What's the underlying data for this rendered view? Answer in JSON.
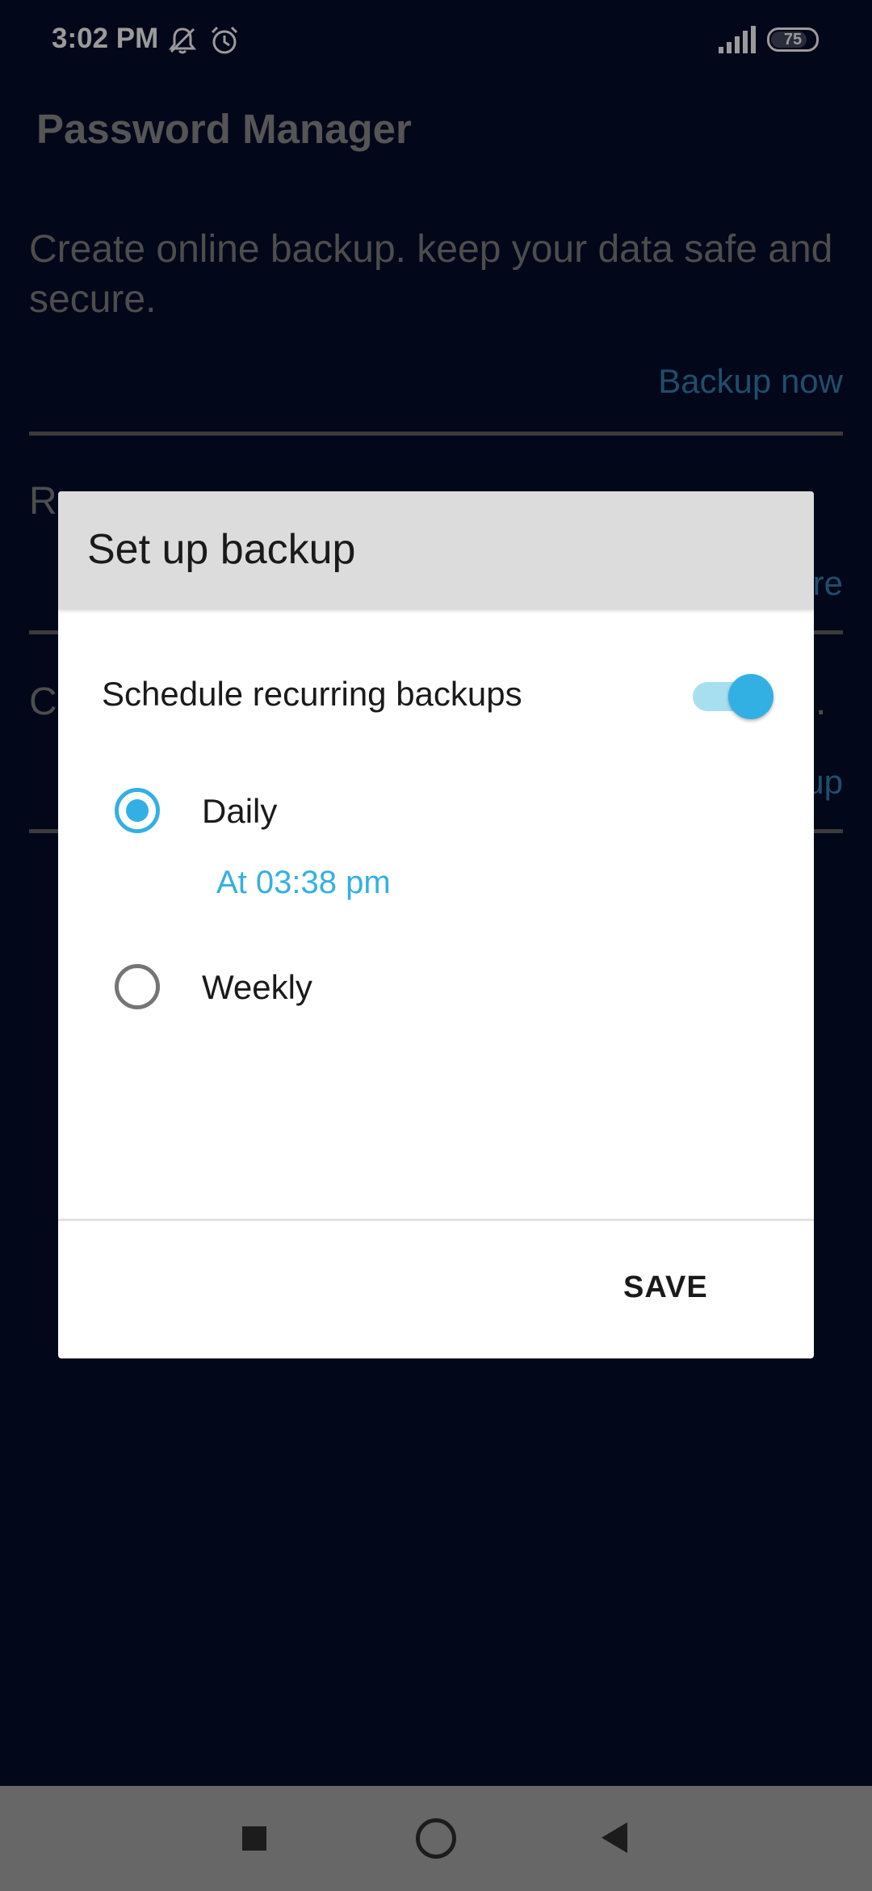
{
  "status_bar": {
    "time": "3:02 PM",
    "icons": [
      "bell-muted-icon",
      "alarm-icon",
      "signal-icon",
      "battery-icon"
    ],
    "battery_level": "75"
  },
  "app": {
    "title": "Password Manager",
    "backup_section": {
      "description": "Create online backup. keep your data safe and secure.",
      "action": "Backup now"
    },
    "restore_section": {
      "description_partial": "R",
      "action_partial": "re"
    },
    "third_section": {
      "description_partial": "C",
      "description_tail": ".",
      "action_partial": "up"
    }
  },
  "dialog": {
    "title": "Set up backup",
    "schedule_label": "Schedule recurring backups",
    "schedule_enabled": true,
    "options": [
      {
        "label": "Daily",
        "selected": true
      },
      {
        "label": "Weekly",
        "selected": false
      }
    ],
    "daily_time": "At 03:38 pm",
    "save_label": "SAVE"
  },
  "colors": {
    "background": "#03071a",
    "accent": "#33b0e3",
    "dialog_header": "#dcdcdd",
    "nav_bar": "#676767"
  }
}
